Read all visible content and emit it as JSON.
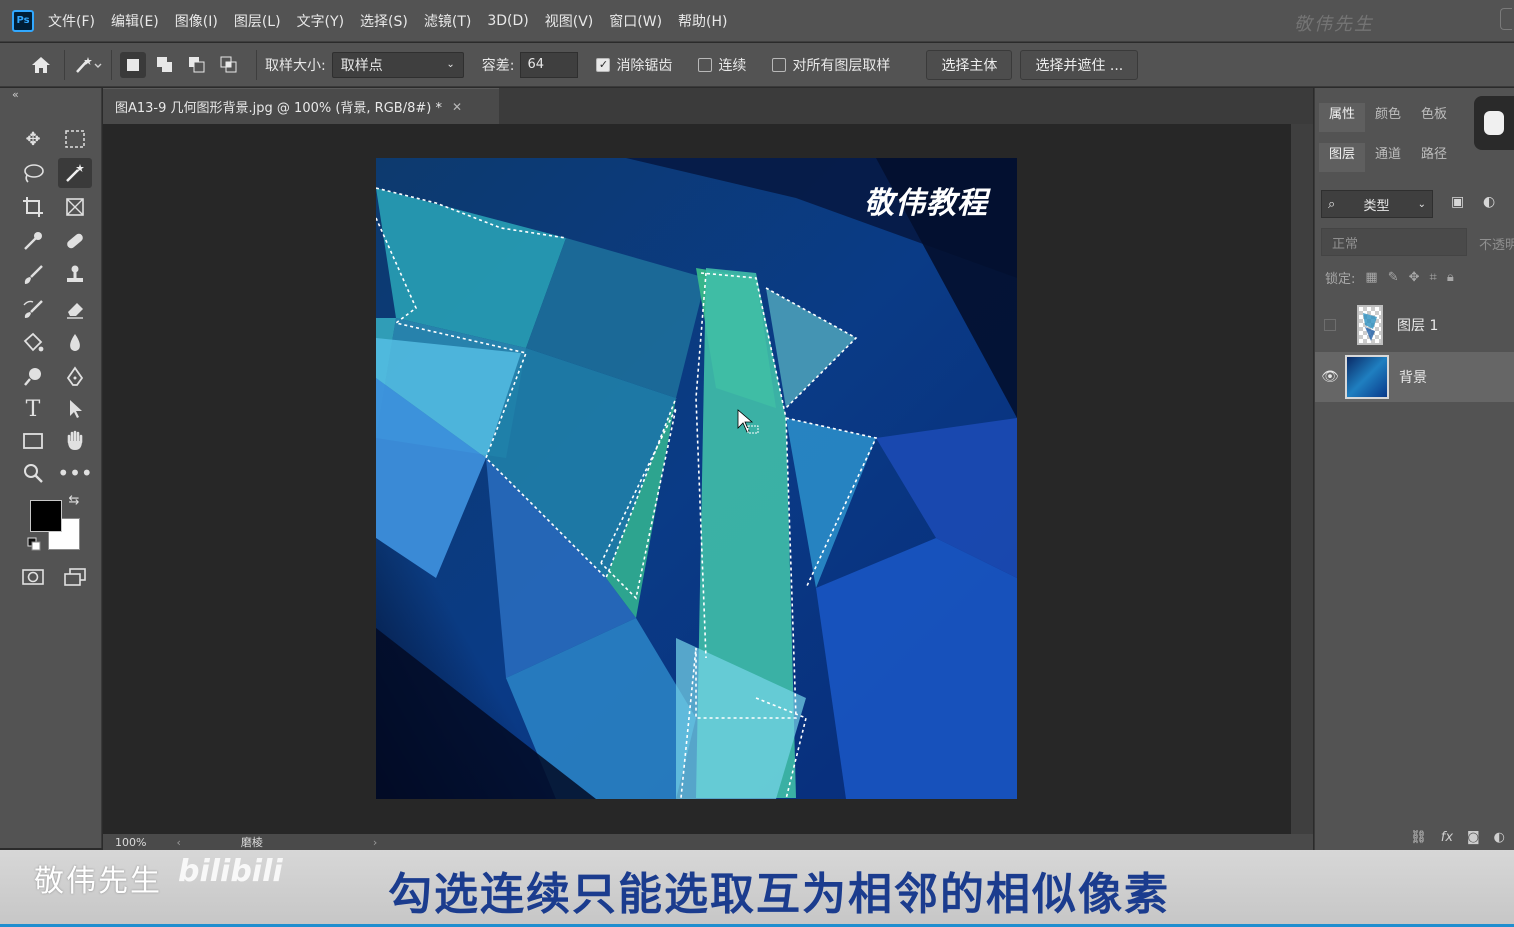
{
  "app": {
    "logo_text": "Ps",
    "menu": [
      "文件(F)",
      "编辑(E)",
      "图像(I)",
      "图层(L)",
      "文字(Y)",
      "选择(S)",
      "滤镜(T)",
      "3D(D)",
      "视图(V)",
      "窗口(W)",
      "帮助(H)"
    ],
    "top_watermark": "敬伟先生"
  },
  "options": {
    "sample_size_label": "取样大小:",
    "sample_size_value": "取样点",
    "tolerance_label": "容差:",
    "tolerance_value": "64",
    "antialias_label": "消除锯齿",
    "antialias_checked": true,
    "contiguous_label": "连续",
    "contiguous_checked": false,
    "all_layers_label": "对所有图层取样",
    "all_layers_checked": false,
    "select_subject_label": "选择主体",
    "select_mask_label": "选择并遮住 ..."
  },
  "document": {
    "tab_title": "图A13-9 几何图形背景.jpg @ 100% (背景, RGB/8#) *",
    "canvas_watermark": "敬伟教程",
    "zoom": "100%",
    "status_text": "磨棱"
  },
  "panels": {
    "top_tabs": [
      "属性",
      "颜色",
      "色板"
    ],
    "layer_tabs": [
      "图层",
      "通道",
      "路径"
    ],
    "filter_label": "类型",
    "blend_mode": "正常",
    "opacity_label": "不透明",
    "lock_label": "锁定:",
    "layers": [
      {
        "name": "图层 1",
        "visible": false,
        "selected": false
      },
      {
        "name": "背景",
        "visible": true,
        "selected": true
      }
    ]
  },
  "caption": {
    "brand": "敬伟先生",
    "platform": "bilibili",
    "text": "勾选连续只能选取互为相邻的相似像素"
  },
  "colors": {
    "ui_bg": "#535353",
    "canvas_bg": "#272727",
    "caption_text": "#1b3c8e",
    "accent": "#31a8ff"
  }
}
